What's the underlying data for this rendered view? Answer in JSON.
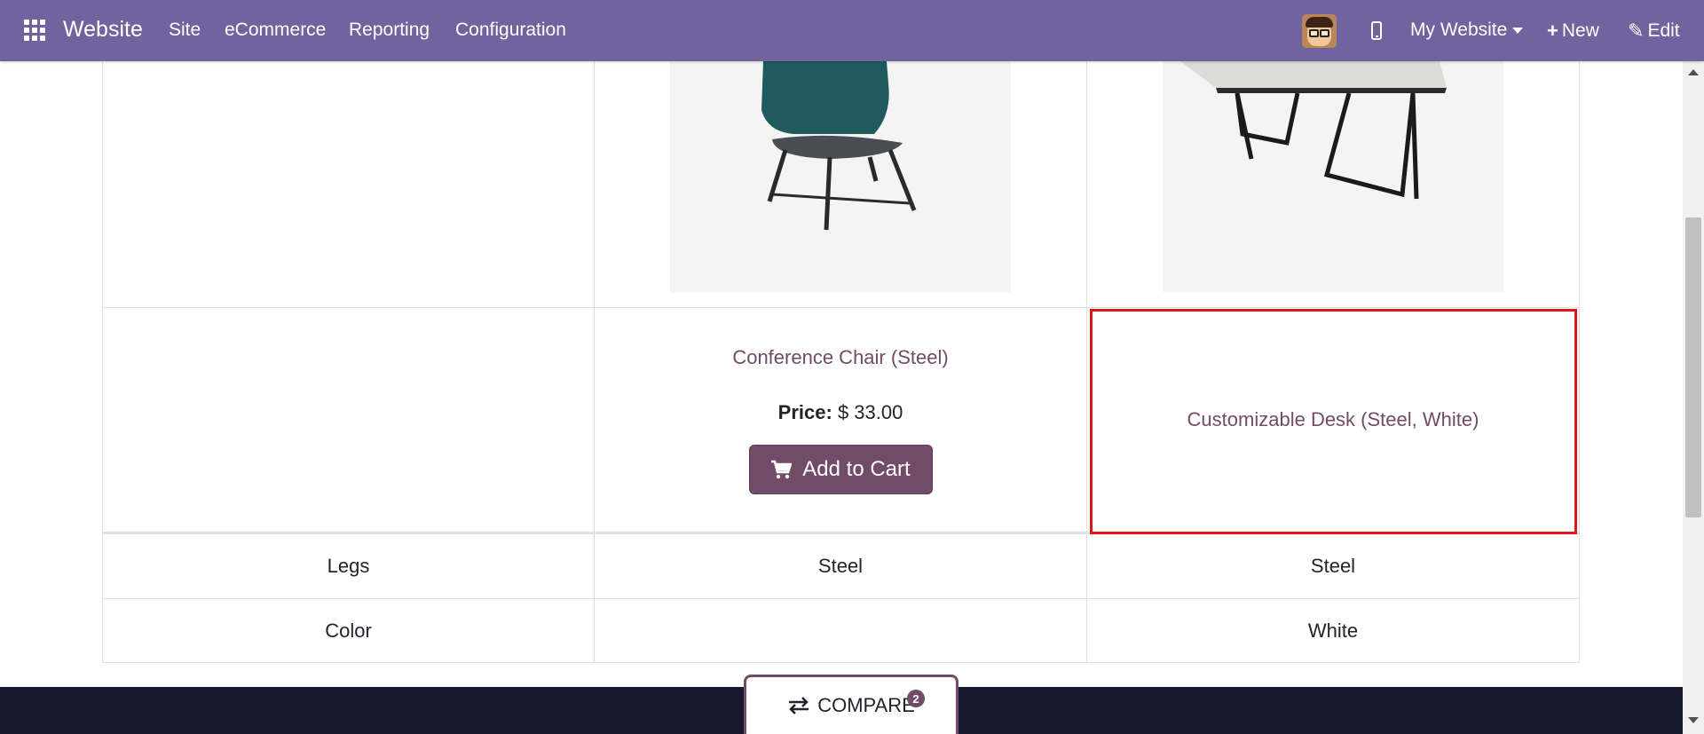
{
  "navbar": {
    "brand": "Website",
    "menus": [
      "Site",
      "eCommerce",
      "Reporting",
      "Configuration"
    ],
    "my_website": "My Website",
    "new_label": "New",
    "edit_label": "Edit",
    "bg_color": "#71639e"
  },
  "products": [
    {
      "name": "Conference Chair (Steel)",
      "price_label": "Price:",
      "price": "$ 33.00",
      "cart_label": "Add to Cart"
    },
    {
      "name": "Customizable Desk (Steel, White)"
    }
  ],
  "attributes": [
    {
      "label": "Legs",
      "values": [
        "Steel",
        "Steel"
      ]
    },
    {
      "label": "Color",
      "values": [
        "",
        "White"
      ]
    }
  ],
  "compare": {
    "label": "COMPARE",
    "count": "2"
  },
  "colors": {
    "accent": "#714b67",
    "highlight": "#e01515",
    "footer": "#141a2b"
  }
}
